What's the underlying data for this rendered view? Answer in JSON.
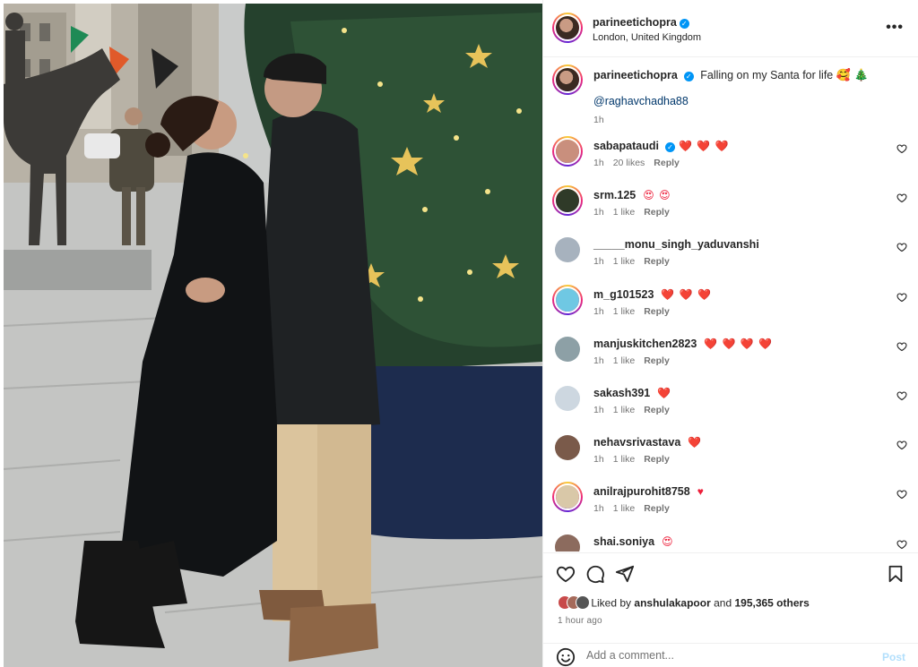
{
  "post": {
    "username": "parineetichopra",
    "location": "London, United Kingdom",
    "caption": "Falling on my Santa for life",
    "caption_emoji": "🥰 🎄",
    "mention": "@raghavchadha88",
    "time": "1h"
  },
  "comments": [
    {
      "username": "sabapataudi",
      "verified": true,
      "text": "❤️ ❤️ ❤️",
      "time": "1h",
      "likes": "20 likes",
      "reply": "Reply",
      "avatar_color": "#c98f7d",
      "story_ring": true
    },
    {
      "username": "srm.125",
      "verified": false,
      "text": "😍 😍",
      "time": "1h",
      "likes": "1 like",
      "reply": "Reply",
      "avatar_color": "#2f3a28",
      "story_ring": true
    },
    {
      "username": "_____monu_singh_yaduvanshi",
      "verified": false,
      "text": "",
      "time": "1h",
      "likes": "1 like",
      "reply": "Reply",
      "avatar_color": "#a7b2be",
      "story_ring": false
    },
    {
      "username": "m_g101523",
      "verified": false,
      "text": "❤️ ❤️ ❤️",
      "time": "1h",
      "likes": "1 like",
      "reply": "Reply",
      "avatar_color": "#6fc8e3",
      "story_ring": true
    },
    {
      "username": "manjuskitchen2823",
      "verified": false,
      "text": "❤️ ❤️ ❤️ ❤️",
      "time": "1h",
      "likes": "1 like",
      "reply": "Reply",
      "avatar_color": "#8da0a6",
      "story_ring": false
    },
    {
      "username": "sakash391",
      "verified": false,
      "text": "❤️",
      "time": "1h",
      "likes": "1 like",
      "reply": "Reply",
      "avatar_color": "#cdd7e0",
      "story_ring": false
    },
    {
      "username": "nehavsrivastava",
      "verified": false,
      "text": "❤️",
      "time": "1h",
      "likes": "1 like",
      "reply": "Reply",
      "avatar_color": "#7a5a4a",
      "story_ring": false
    },
    {
      "username": "anilrajpurohit8758",
      "verified": false,
      "text": "♥",
      "time": "1h",
      "likes": "1 like",
      "reply": "Reply",
      "avatar_color": "#d9c8a8",
      "story_ring": true
    },
    {
      "username": "shai.soniya",
      "verified": false,
      "text": "😍",
      "time": "",
      "likes": "",
      "reply": "",
      "avatar_color": "#8c6b5e",
      "story_ring": false
    }
  ],
  "likes": {
    "prefix": "Liked by",
    "user": "anshulakapoor",
    "conjunction": "and",
    "count": "195,365 others"
  },
  "time_ago": "1 hour ago",
  "add_comment": {
    "placeholder": "Add a comment...",
    "post_label": "Post"
  },
  "icons": {
    "more": "more-options-icon",
    "like": "heart-icon",
    "comment": "comment-bubble-icon",
    "share": "paper-plane-icon",
    "save": "bookmark-icon",
    "emoji": "smiley-icon",
    "verified": "verified-badge-icon"
  },
  "colors": {
    "link": "#00376b",
    "verified": "#0095f6",
    "muted": "#737373",
    "heart": "#ed1f3a",
    "post_button": "#b2dffc"
  }
}
